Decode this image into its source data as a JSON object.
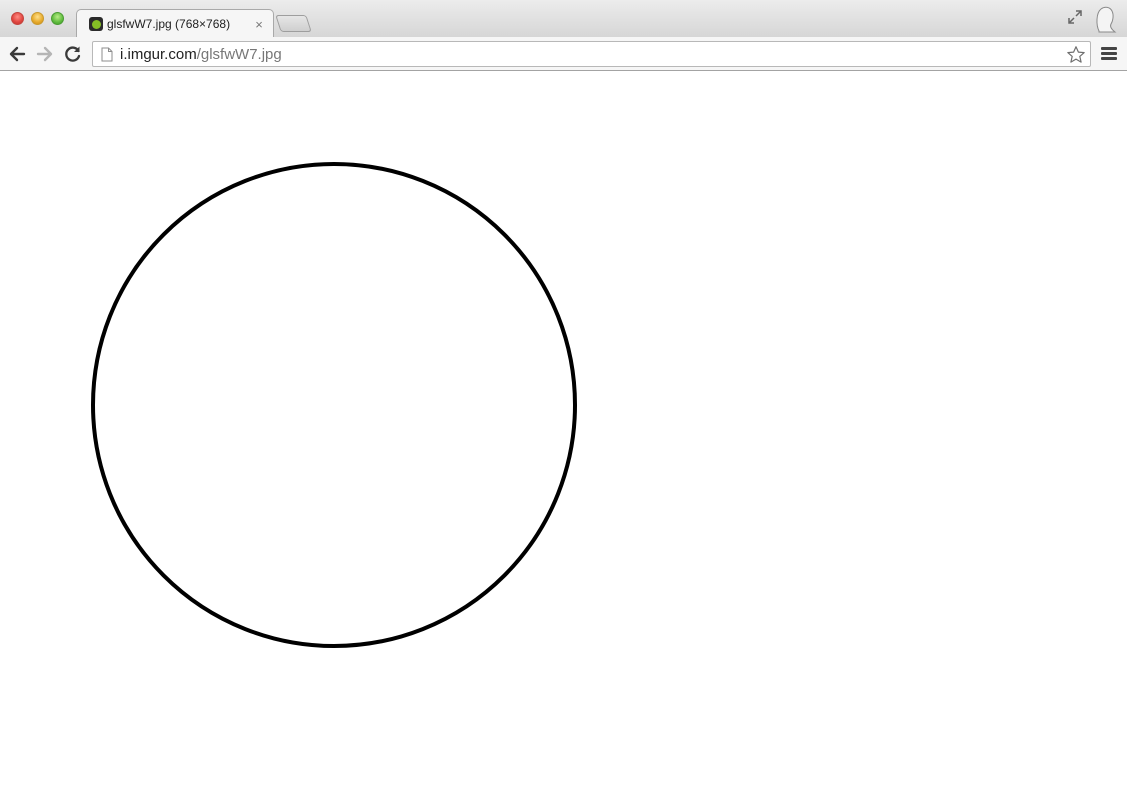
{
  "window": {
    "controls": [
      "close",
      "minimize",
      "zoom"
    ]
  },
  "tab": {
    "title": "glsfwW7.jpg (768×768)",
    "close_label": "×",
    "favicon": "imgur-favicon",
    "active": true
  },
  "toolbar": {
    "back_icon": "arrow-left-icon",
    "forward_icon": "arrow-right-icon",
    "forward_enabled": false,
    "reload_icon": "reload-icon",
    "menu_icon": "hamburger-menu-icon"
  },
  "omnibox": {
    "host": "i.imgur.com",
    "path": "/glsfwW7.jpg",
    "bookmark_icon": "star-outline-icon"
  },
  "content": {
    "image": {
      "shape": "circle-outline",
      "stroke_color": "#000000",
      "fill_color": "#ffffff"
    }
  },
  "colors": {
    "page_background": "#ffffff",
    "chrome_background": "#f6f6f6"
  }
}
